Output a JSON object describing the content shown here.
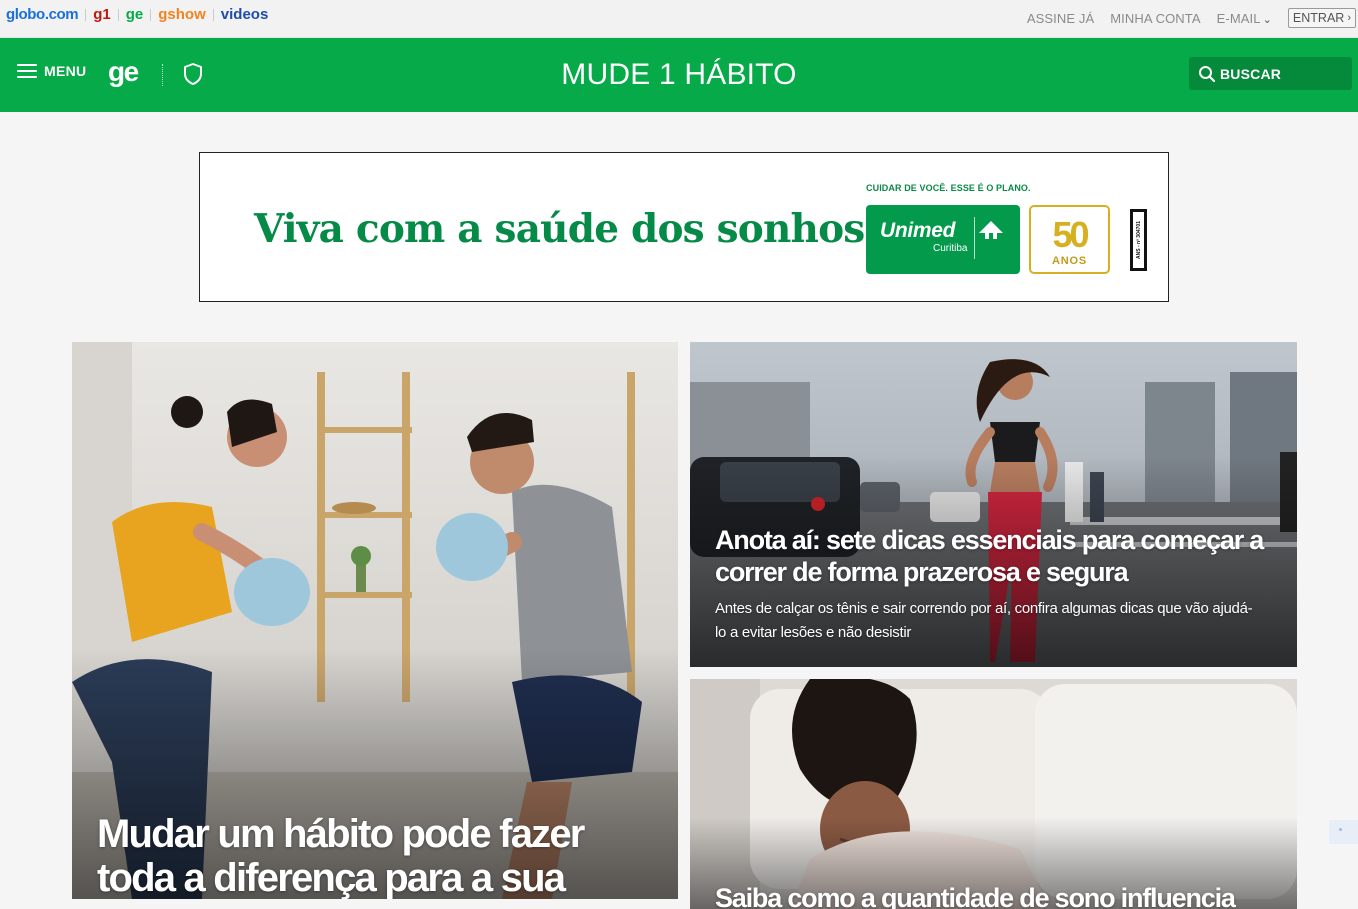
{
  "topbar": {
    "brands": [
      "globo.com",
      "g1",
      "ge",
      "gshow",
      "videos"
    ],
    "links": {
      "assine": "ASSINE JÁ",
      "conta": "MINHA CONTA",
      "email": "E-MAIL"
    },
    "entrar": "ENTRAR"
  },
  "header": {
    "menu_label": "MENU",
    "logo": "ge",
    "title": "MUDE 1 HÁBITO",
    "search_label": "BUSCAR",
    "color": "#06aa48"
  },
  "ad": {
    "headline": "Viva com a saúde dos sonhos.",
    "tagline": "CUIDAR DE VOCÊ. ESSE É O PLANO.",
    "brand": "Unimed",
    "city": "Curitiba",
    "years_number": "50",
    "years_label": "ANOS",
    "ans": "ANS - nº 304701"
  },
  "cards": {
    "main": {
      "title": "Mudar um hábito pode fazer toda a diferença para a sua"
    },
    "run": {
      "title": "Anota aí: sete dicas essenciais para começar a correr de forma prazerosa e segura",
      "summary": "Antes de calçar os tênis e sair correndo por aí, confira algumas dicas que vão ajudá-lo a evitar lesões e não desistir"
    },
    "sleep": {
      "title": "Saiba como a quantidade de sono influencia diretamente"
    }
  }
}
